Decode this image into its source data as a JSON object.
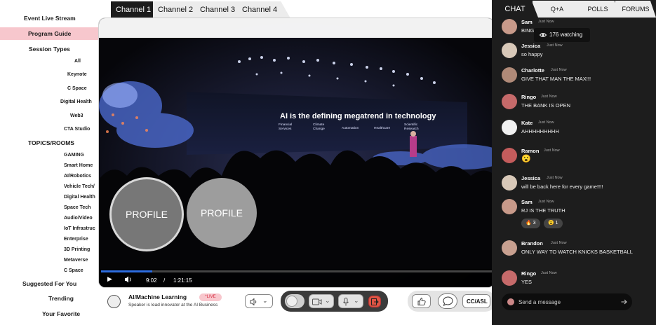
{
  "sidebar": {
    "event_live_stream": "Event Live Stream",
    "program_guide": "Program Guide",
    "session_types": "Session Types",
    "sessions": [
      "All",
      "Keynote",
      "C Space",
      "Digital Health",
      "Web3",
      "CTA Studio"
    ],
    "topics_rooms": "TOPICS/ROOMS",
    "topics": [
      "GAMING",
      "Smart Home",
      "AI/Robotics",
      "Vehicle Tech/",
      "Digital Health",
      "Space Tech",
      "Audio/Video",
      "IoT Infrastruc",
      "Enterprise",
      "3D Printing",
      "Metaverse",
      "C Space"
    ],
    "suggested": "Suggested For You",
    "trending": "Trending",
    "favorite": "Your Favorite"
  },
  "channels": [
    "Channel 1",
    "Channel 2",
    "Channel 3",
    "Channel 4"
  ],
  "video": {
    "headline": "AI is the defining megatrend in technology",
    "stage_topics": [
      "Financial\nServices",
      "Climate\nChange",
      "Automation",
      "Healthcare",
      "Scientific\nResearch"
    ],
    "profiles": [
      "PROFILE",
      "PROFILE"
    ],
    "current_time": "9:02",
    "separator": "/",
    "duration": "1:21:15",
    "progress_fraction": 0.13
  },
  "bottom": {
    "track_title": "AI/Machine Learning",
    "live_label": "*LIVE",
    "track_subtitle": "Speaker is lead innovator at the AI Business",
    "cc_label": "CC/ASL",
    "icons": [
      "speaker-icon",
      "camera-icon",
      "microphone-icon",
      "exit-icon",
      "thumbs-up-icon",
      "chat-bubble-icon"
    ]
  },
  "chat": {
    "tabs": [
      "CHAT",
      "Q+A",
      "POLLS",
      "FORUMS"
    ],
    "watching": "176 watching",
    "messages": [
      {
        "name": "Sam",
        "time": "Just Now",
        "text": "BING"
      },
      {
        "name": "Jessica",
        "time": "Just Now",
        "text": "so happy"
      },
      {
        "name": "Charlotte",
        "time": "Just Now",
        "text": "GIVE THAT MAN THE MAX!!!"
      },
      {
        "name": "Ringo",
        "time": "Just Now",
        "text": "THE BANK IS OPEN"
      },
      {
        "name": "Kate",
        "time": "Just Now",
        "text": "AHHHHHHHHH"
      },
      {
        "name": "Ramon",
        "time": "Just Now",
        "text": "😮"
      },
      {
        "name": "Jessica",
        "time": "Just Now",
        "text": "will be back here for every game!!!!"
      },
      {
        "name": "Sam",
        "time": "Just Now",
        "text": "RJ IS THE TRUTH"
      },
      {
        "name": "Brandon",
        "time": "Just Now",
        "text": "ONLY WAY TO WATCH KNICKS BASKETBALL"
      },
      {
        "name": "Ringo",
        "time": "Just Now",
        "text": "YES"
      }
    ],
    "reactions": [
      {
        "emoji": "🔥",
        "count": "3"
      },
      {
        "emoji": "😮",
        "count": "1"
      }
    ],
    "composer_placeholder": "Send a message"
  },
  "colors": {
    "active_nav": "#f7c7cd",
    "chat_bg": "#1d1d1d",
    "live_red": "#d4263b",
    "progress_blue": "#2d6cdf"
  }
}
